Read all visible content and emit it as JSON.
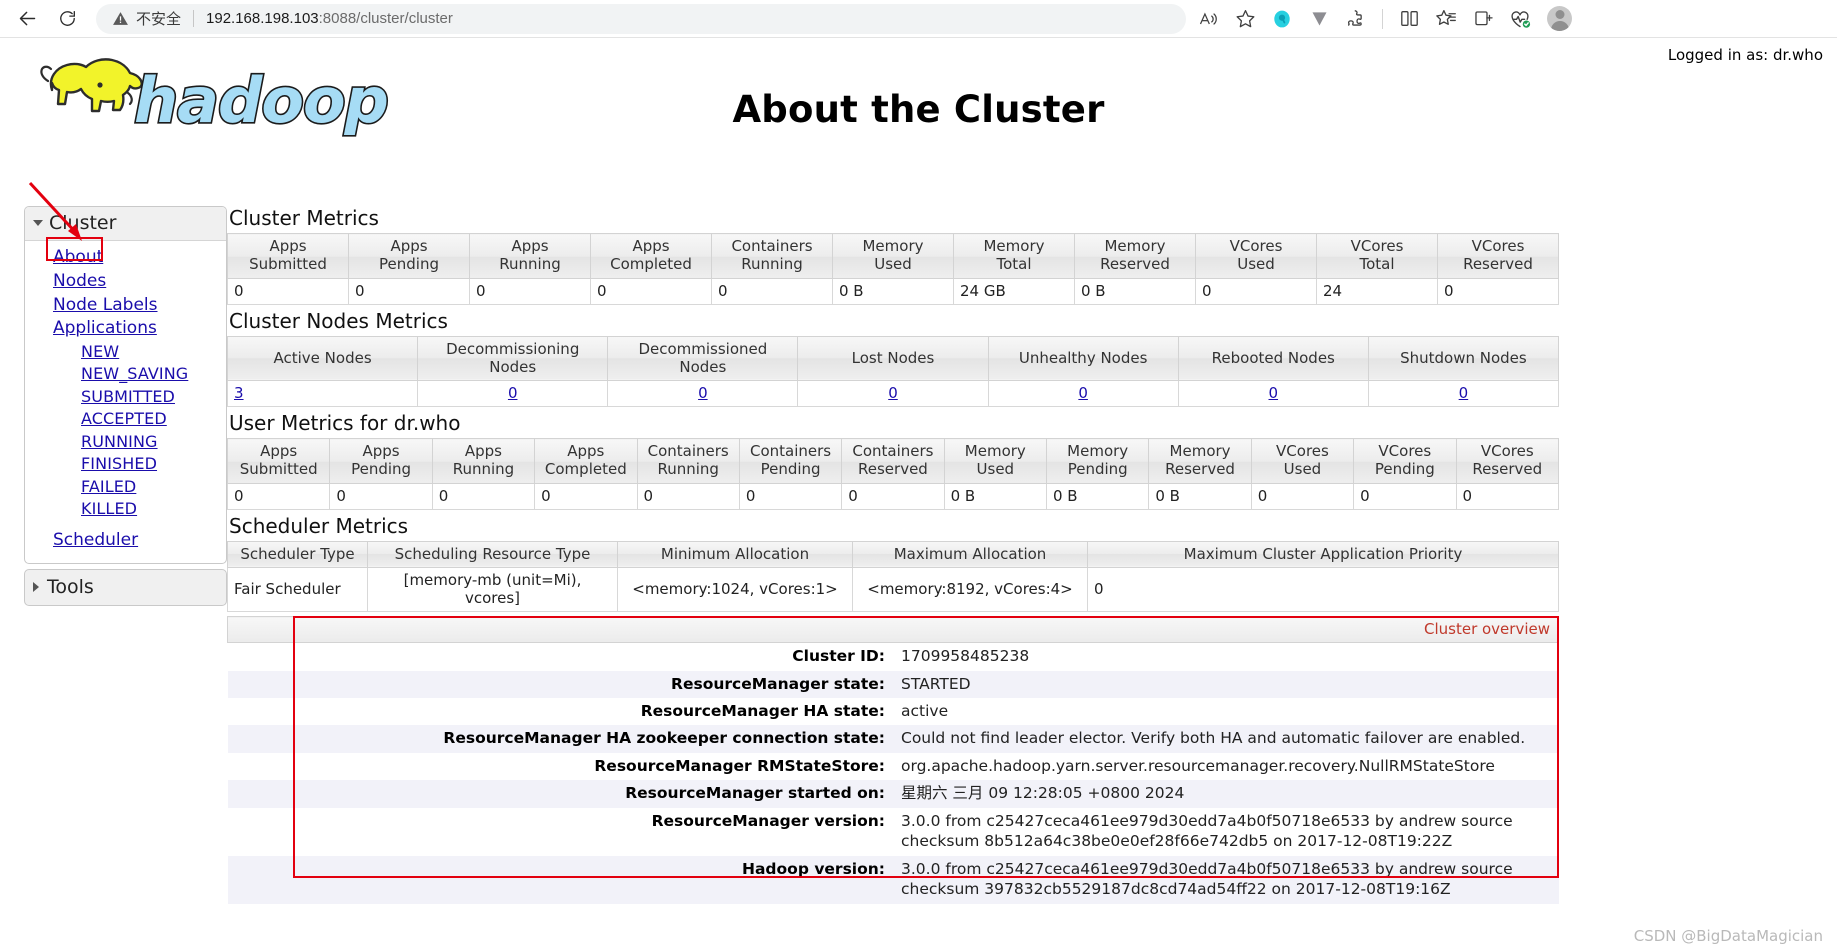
{
  "browser": {
    "back_label": "Back",
    "reload_label": "Reload",
    "security_label": "不安全",
    "url_host": "192.168.198.103",
    "url_path": ":8088/cluster/cluster",
    "icons": {
      "back": "back-arrow-icon",
      "reload": "reload-icon",
      "warning": "warning-triangle-icon",
      "read_aloud": "read-aloud-icon",
      "favorite": "star-icon",
      "ext_quark": "quark-extension-icon",
      "ext_v": "v-extension-icon",
      "ext_puzzle": "puzzle-extension-icon",
      "split_screen": "split-screen-icon",
      "collections": "collections-icon",
      "copilot": "copilot-icon",
      "browser_essentials": "browser-essentials-icon",
      "profile": "profile-avatar-icon"
    }
  },
  "header": {
    "logged_in_as": "Logged in as: dr.who",
    "title": "About the Cluster",
    "logo_text": "hadoop"
  },
  "sidebar": {
    "cluster": {
      "title": "Cluster",
      "items": [
        {
          "label": "About"
        },
        {
          "label": "Nodes"
        },
        {
          "label": "Node Labels"
        },
        {
          "label": "Applications"
        }
      ],
      "app_states": [
        {
          "label": "NEW"
        },
        {
          "label": "NEW_SAVING"
        },
        {
          "label": "SUBMITTED"
        },
        {
          "label": "ACCEPTED"
        },
        {
          "label": "RUNNING"
        },
        {
          "label": "FINISHED"
        },
        {
          "label": "FAILED"
        },
        {
          "label": "KILLED"
        }
      ],
      "scheduler": {
        "label": "Scheduler"
      }
    },
    "tools": {
      "title": "Tools"
    }
  },
  "main": {
    "cluster_metrics": {
      "title": "Cluster Metrics",
      "columns": [
        {
          "l1": "Apps",
          "l2": "Submitted"
        },
        {
          "l1": "Apps",
          "l2": "Pending"
        },
        {
          "l1": "Apps",
          "l2": "Running"
        },
        {
          "l1": "Apps",
          "l2": "Completed"
        },
        {
          "l1": "Containers",
          "l2": "Running"
        },
        {
          "l1": "Memory",
          "l2": "Used"
        },
        {
          "l1": "Memory",
          "l2": "Total"
        },
        {
          "l1": "Memory",
          "l2": "Reserved"
        },
        {
          "l1": "VCores",
          "l2": "Used"
        },
        {
          "l1": "VCores",
          "l2": "Total"
        },
        {
          "l1": "VCores",
          "l2": "Reserved"
        }
      ],
      "values": [
        "0",
        "0",
        "0",
        "0",
        "0",
        "0 B",
        "24 GB",
        "0 B",
        "0",
        "24",
        "0"
      ]
    },
    "cluster_nodes_metrics": {
      "title": "Cluster Nodes Metrics",
      "columns": [
        "Active Nodes",
        "Decommissioning Nodes",
        "Decommissioned Nodes",
        "Lost Nodes",
        "Unhealthy Nodes",
        "Rebooted Nodes",
        "Shutdown Nodes"
      ],
      "values": [
        "3",
        "0",
        "0",
        "0",
        "0",
        "0",
        "0"
      ]
    },
    "user_metrics": {
      "title": "User Metrics for dr.who",
      "columns": [
        {
          "l1": "Apps",
          "l2": "Submitted"
        },
        {
          "l1": "Apps",
          "l2": "Pending"
        },
        {
          "l1": "Apps",
          "l2": "Running"
        },
        {
          "l1": "Apps",
          "l2": "Completed"
        },
        {
          "l1": "Containers",
          "l2": "Running"
        },
        {
          "l1": "Containers",
          "l2": "Pending"
        },
        {
          "l1": "Containers",
          "l2": "Reserved"
        },
        {
          "l1": "Memory",
          "l2": "Used"
        },
        {
          "l1": "Memory",
          "l2": "Pending"
        },
        {
          "l1": "Memory",
          "l2": "Reserved"
        },
        {
          "l1": "VCores",
          "l2": "Used"
        },
        {
          "l1": "VCores",
          "l2": "Pending"
        },
        {
          "l1": "VCores",
          "l2": "Reserved"
        }
      ],
      "values": [
        "0",
        "0",
        "0",
        "0",
        "0",
        "0",
        "0",
        "0 B",
        "0 B",
        "0 B",
        "0",
        "0",
        "0"
      ]
    },
    "scheduler_metrics": {
      "title": "Scheduler Metrics",
      "columns": [
        "Scheduler Type",
        "Scheduling Resource Type",
        "Minimum Allocation",
        "Maximum Allocation",
        "Maximum Cluster Application Priority"
      ],
      "values": [
        "Fair Scheduler",
        "[memory-mb (unit=Mi), vcores]",
        "<memory:1024, vCores:1>",
        "<memory:8192, vCores:4>",
        "0"
      ]
    },
    "cluster_overview": {
      "caption": "Cluster overview",
      "rows": [
        {
          "key": "Cluster ID:",
          "value": "1709958485238"
        },
        {
          "key": "ResourceManager state:",
          "value": "STARTED"
        },
        {
          "key": "ResourceManager HA state:",
          "value": "active"
        },
        {
          "key": "ResourceManager HA zookeeper connection state:",
          "value": "Could not find leader elector. Verify both HA and automatic failover are enabled."
        },
        {
          "key": "ResourceManager RMStateStore:",
          "value": "org.apache.hadoop.yarn.server.resourcemanager.recovery.NullRMStateStore"
        },
        {
          "key": "ResourceManager started on:",
          "value": "星期六 三月 09 12:28:05 +0800 2024"
        },
        {
          "key": "ResourceManager version:",
          "value": "3.0.0 from c25427ceca461ee979d30edd7a4b0f50718e6533 by andrew source checksum 8b512a64c38be0e0ef28f66e742db5 on 2017-12-08T19:22Z"
        },
        {
          "key": "Hadoop version:",
          "value": "3.0.0 from c25427ceca461ee979d30edd7a4b0f50718e6533 by andrew source checksum 397832cb5529187dc8cd74ad54ff22 on 2017-12-08T19:16Z"
        }
      ]
    }
  },
  "watermark": {
    "text": "CSDN @BigDataMagician"
  },
  "colors": {
    "link": "#1a0dab",
    "annotation": "#e3000f",
    "caption": "#c0392b",
    "logo_elephant": "#f2f32a",
    "logo_text": "#a6dcf5"
  }
}
